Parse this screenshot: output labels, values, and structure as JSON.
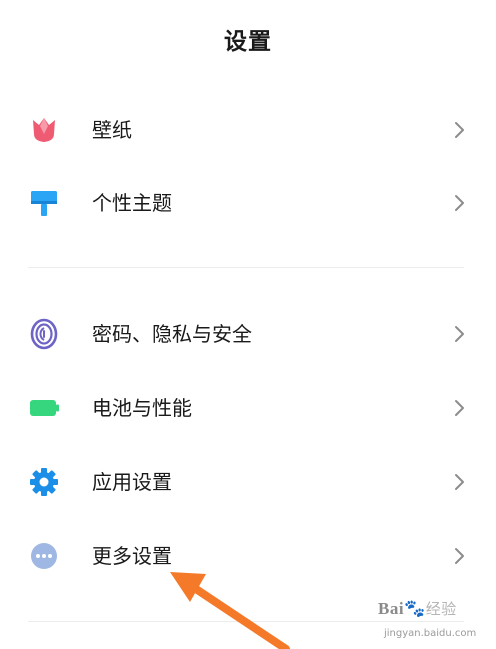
{
  "header": {
    "title": "设置"
  },
  "settings": {
    "items": [
      {
        "label": "壁纸",
        "icon": "tulip-icon",
        "color": "#ef5b73"
      },
      {
        "label": "个性主题",
        "icon": "paint-roller-icon",
        "color": "#2aa4f4"
      },
      {
        "label": "密码、隐私与安全",
        "icon": "fingerprint-icon",
        "color": "#6d64c6"
      },
      {
        "label": "电池与性能",
        "icon": "battery-icon",
        "color": "#35d67e"
      },
      {
        "label": "应用设置",
        "icon": "gear-icon",
        "color": "#1b8fe8"
      },
      {
        "label": "更多设置",
        "icon": "more-dots-icon",
        "color": "#9fb7e3"
      }
    ]
  },
  "annotation": {
    "arrow_color": "#f47a2a"
  },
  "watermark": {
    "brand": "Bai",
    "brand_cn": "经验",
    "url": "jingyan.baidu.com"
  }
}
